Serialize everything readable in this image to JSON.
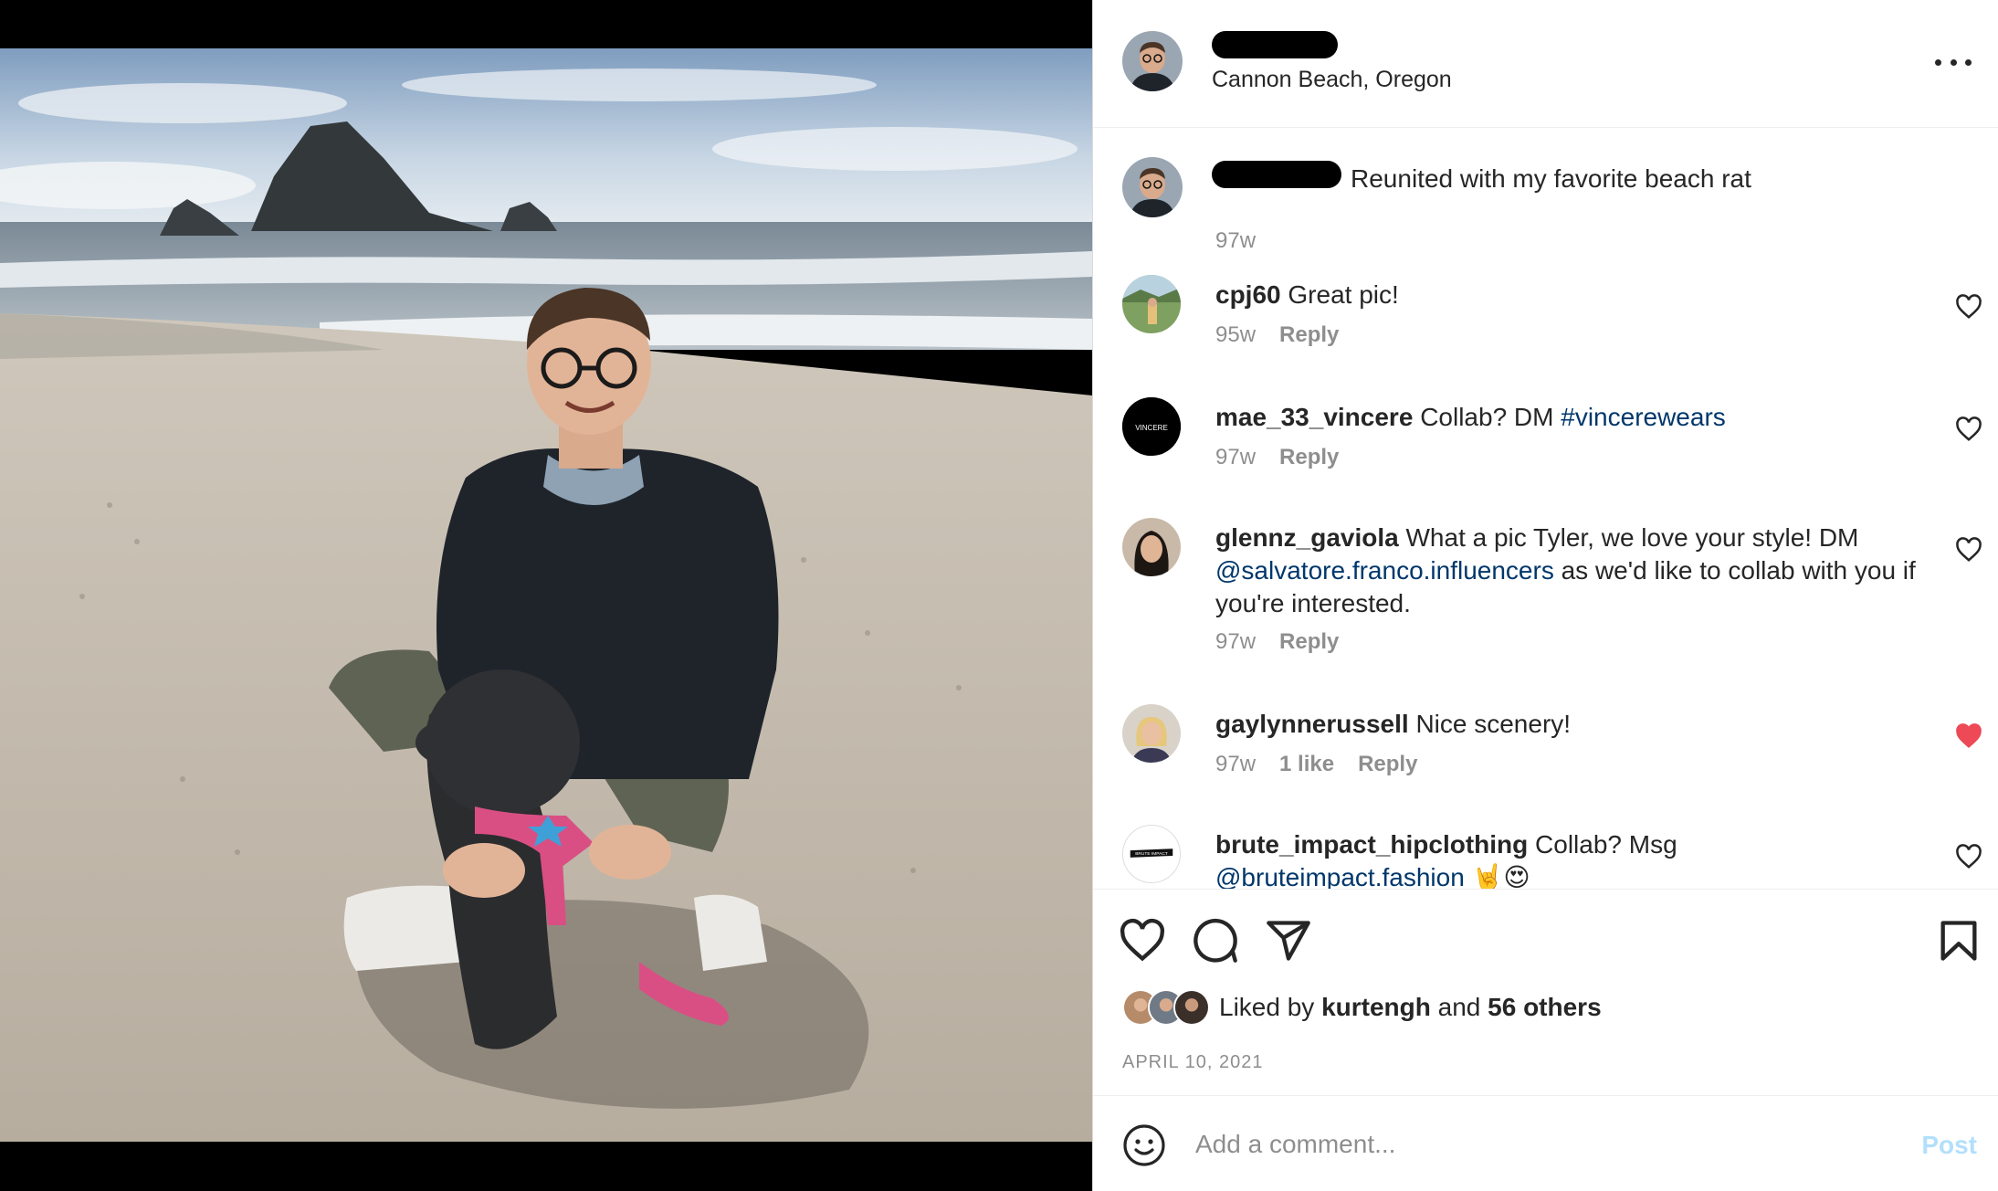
{
  "post": {
    "location": "Cannon Beach, Oregon"
  },
  "comments": [
    {
      "user": "",
      "text": "Reunited with my favorite beach rat",
      "age": "97w"
    },
    {
      "user": "cpj60",
      "text": "Great pic!",
      "age": "95w",
      "reply": "Reply"
    },
    {
      "user": "mae_33_vincere",
      "text": "Collab? DM",
      "tag": "#vincerewears",
      "age": "97w",
      "reply": "Reply",
      "avatar_text": "VINCERE"
    },
    {
      "user": "glennz_gaviola",
      "text_a": "What a pic Tyler, we love your style! DM",
      "mention": "@salvatore.franco.influencers",
      "text_b": "as we'd like to collab with you if you're interested.",
      "age": "97w",
      "reply": "Reply"
    },
    {
      "user": "gaylynnerussell",
      "text": "Nice scenery!",
      "age": "97w",
      "likes": "1 like",
      "reply": "Reply",
      "liked": true
    },
    {
      "user": "brute_impact_hipclothing",
      "text": "Collab? Msg",
      "mention": "@bruteimpact.fashion",
      "emoji": "🤘😍",
      "avatar_text": "BRUTE IMPACT"
    }
  ],
  "likes": {
    "prefix": "Liked by",
    "user": "kurtengh",
    "and": "and",
    "others": "56 others"
  },
  "date": "APRIL 10, 2021",
  "composer": {
    "placeholder": "Add a comment...",
    "post_label": "Post"
  },
  "colors": {
    "link": "#00376b",
    "muted": "#8e8e8e",
    "liked_heart": "#ed4956",
    "post_disabled": "#b2dffc"
  },
  "icons": [
    "more-icon",
    "heart-icon",
    "comment-icon",
    "share-icon",
    "bookmark-icon",
    "emoji-icon"
  ]
}
